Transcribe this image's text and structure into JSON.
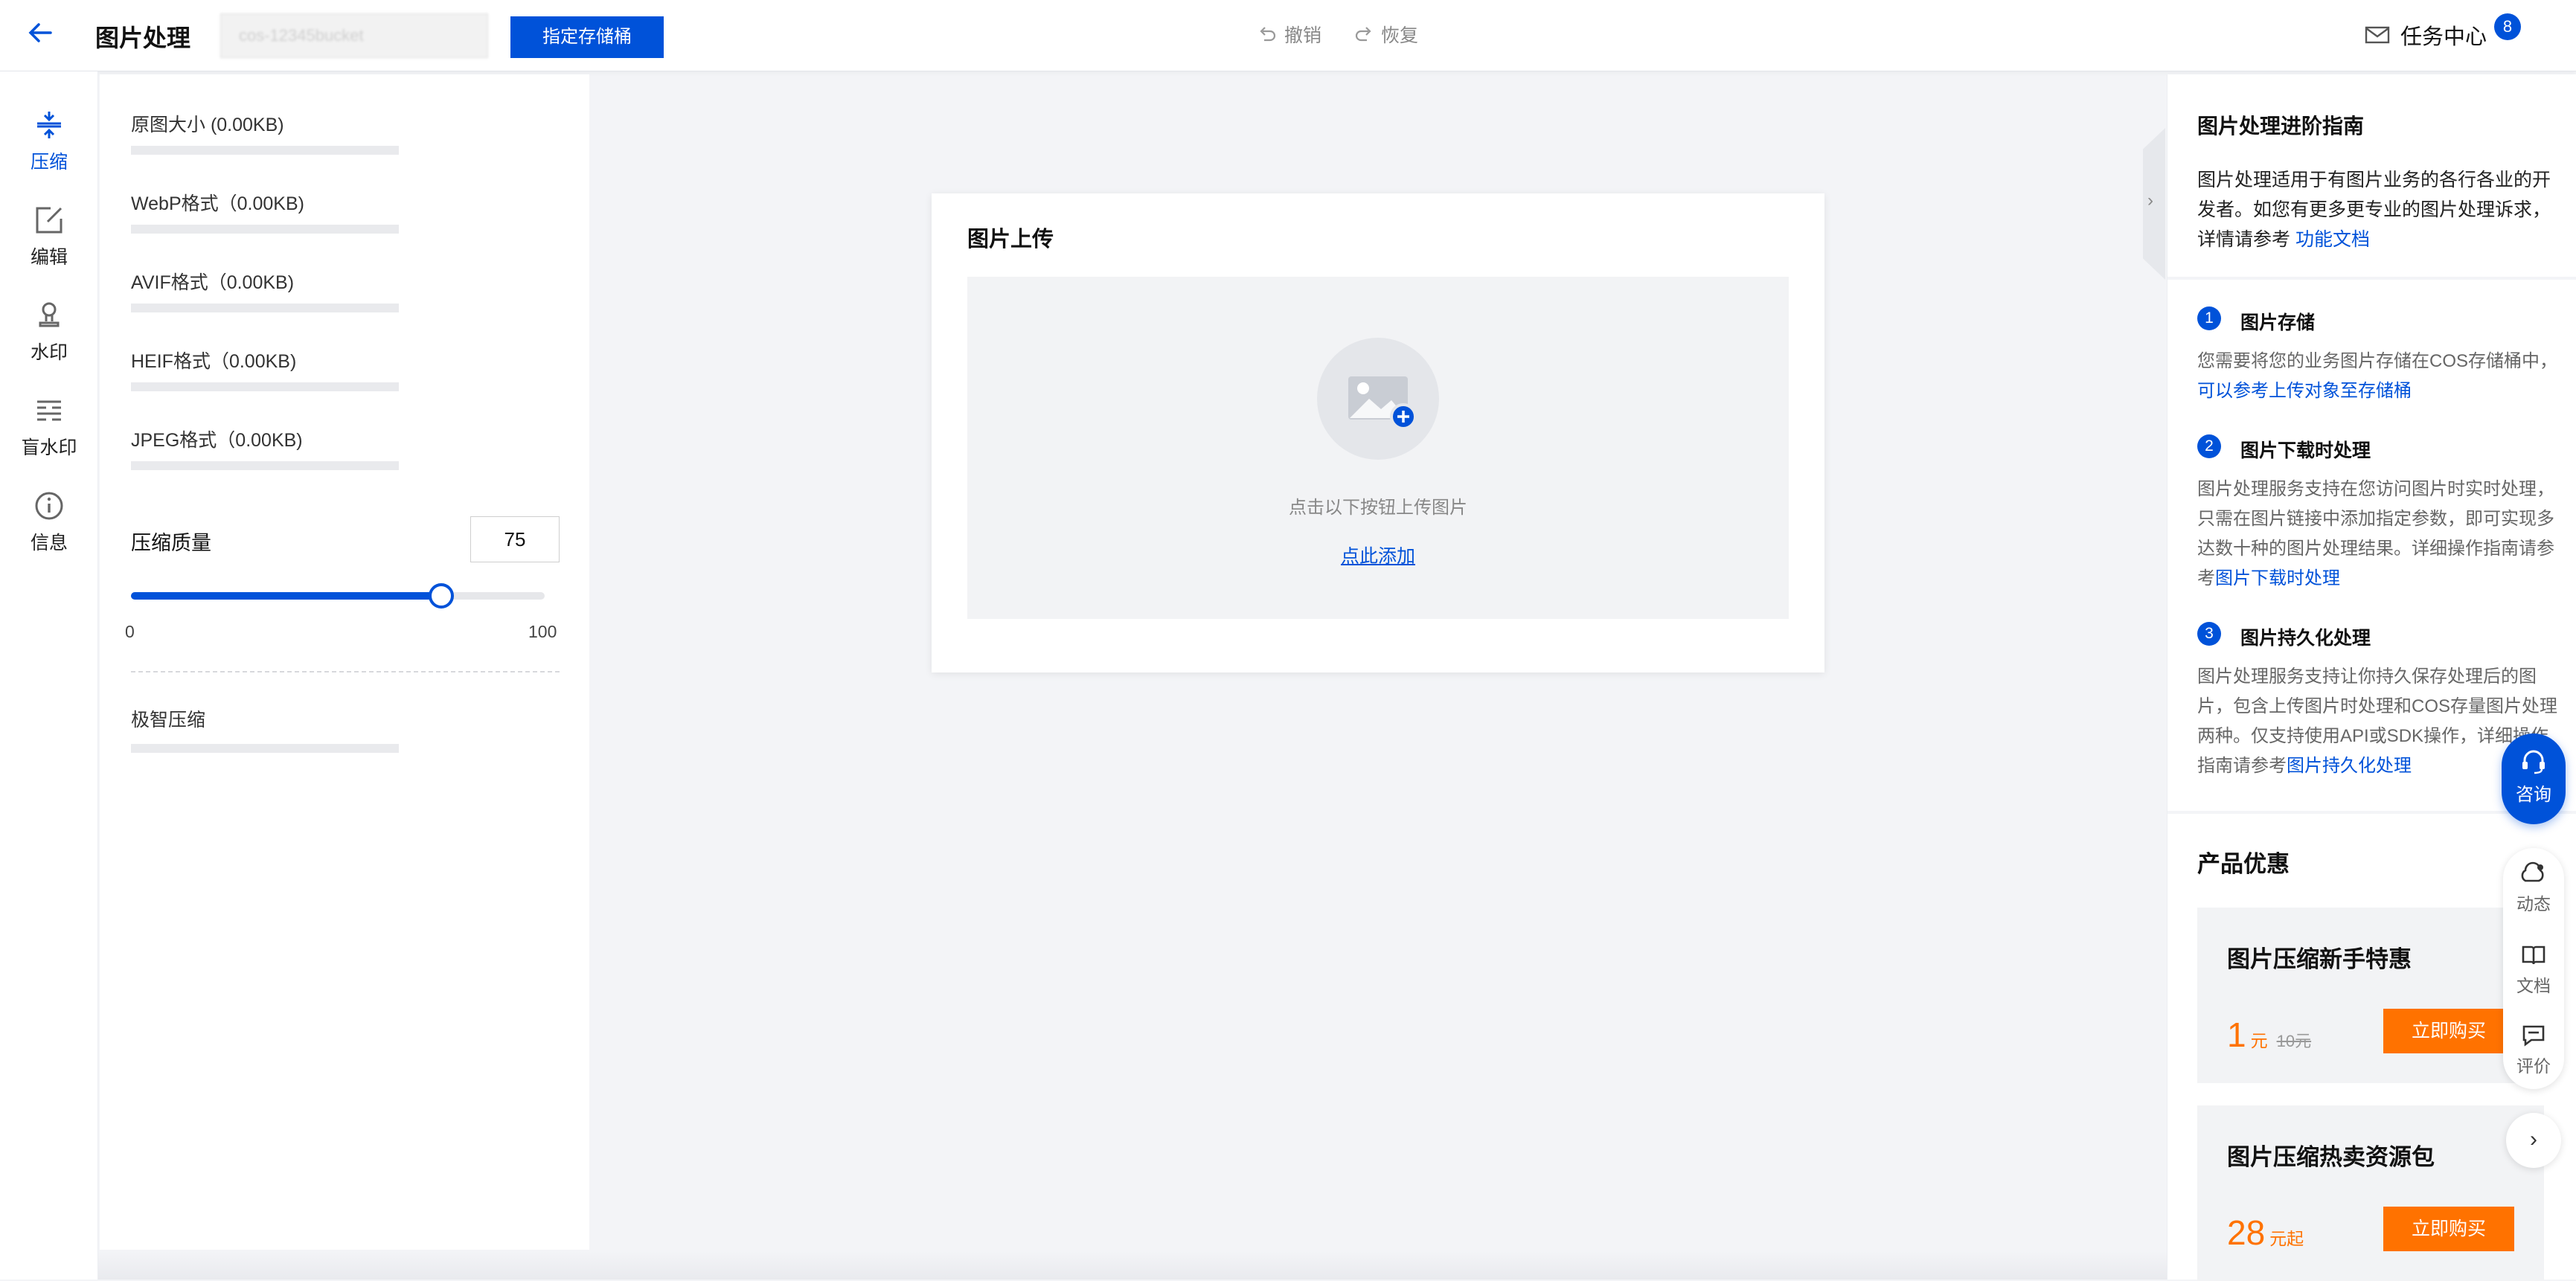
{
  "topbar": {
    "title": "图片处理",
    "bucket_placeholder": "cos-12345bucket",
    "bucket_button": "指定存储桶",
    "undo": "撤销",
    "redo": "恢复",
    "tasks_label": "任务中心",
    "tasks_count": "8"
  },
  "leftnav": {
    "items": [
      {
        "label": "压缩",
        "icon": "compress-icon",
        "active": true
      },
      {
        "label": "编辑",
        "icon": "edit-icon",
        "active": false
      },
      {
        "label": "水印",
        "icon": "watermark-icon",
        "active": false
      },
      {
        "label": "盲水印",
        "icon": "blind-watermark-icon",
        "active": false
      },
      {
        "label": "信息",
        "icon": "info-icon",
        "active": false
      }
    ]
  },
  "settings": {
    "formats": [
      {
        "label": "原图大小 (0.00KB)"
      },
      {
        "label": "WebP格式（0.00KB)"
      },
      {
        "label": "AVIF格式（0.00KB)"
      },
      {
        "label": "HEIF格式（0.00KB)"
      },
      {
        "label": "JPEG格式（0.00KB)"
      }
    ],
    "quality_label": "压缩质量",
    "quality_value": "75",
    "quality_fraction": 0.75,
    "slider_min": "0",
    "slider_max": "100",
    "smart_label": "极智压缩"
  },
  "upload": {
    "title": "图片上传",
    "hint": "点击以下按钮上传图片",
    "link": "点此添加"
  },
  "guide": {
    "title": "图片处理进阶指南",
    "intro": "图片处理适用于有图片业务的各行各业的开发者。如您有更多更专业的图片处理诉求，详情请参考",
    "intro_link": "功能文档",
    "steps": [
      {
        "num": "1",
        "title": "图片存储",
        "body": "您需要将您的业务图片存储在COS存储桶中，",
        "link": "可以参考上传对象至存储桶"
      },
      {
        "num": "2",
        "title": "图片下载时处理",
        "body": "图片处理服务支持在您访问图片时实时处理，只需在图片链接中添加指定参数，即可实现多达数十种的图片处理结果。详细操作指南请参考",
        "link": "图片下载时处理"
      },
      {
        "num": "3",
        "title": "图片持久化处理",
        "body": "图片处理服务支持让你持久保存处理后的图片，包含上传图片时处理和COS存量图片处理两种。仅支持使用API或SDK操作，详细操作指南请参考",
        "link": "图片持久化处理"
      }
    ]
  },
  "promo": {
    "title": "产品优惠",
    "cards": [
      {
        "name": "图片压缩新手特惠",
        "price": "1",
        "unit": "元",
        "old_price": "10元",
        "button": "立即购买"
      },
      {
        "name": "图片压缩热卖资源包",
        "price": "28",
        "unit": "元起",
        "old_price": "",
        "button": "立即购买"
      }
    ]
  },
  "floating": {
    "consult": "咨询",
    "items": [
      {
        "label": "动态",
        "icon": "news-icon"
      },
      {
        "label": "文档",
        "icon": "doc-icon"
      },
      {
        "label": "评价",
        "icon": "feedback-icon"
      }
    ]
  },
  "colors": {
    "accent": "#0052d9",
    "promo": "#ff7200"
  }
}
